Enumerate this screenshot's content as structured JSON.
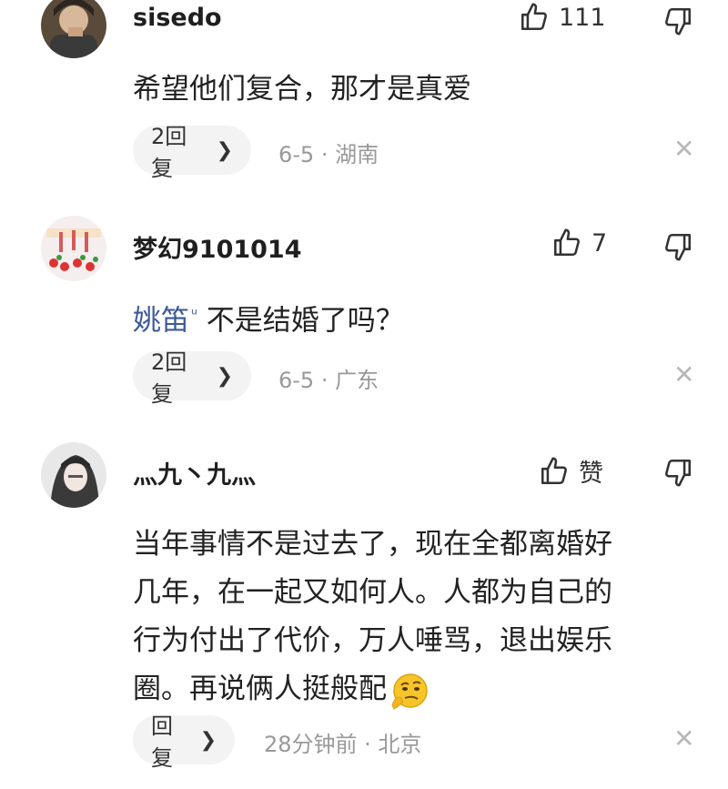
{
  "comments": [
    {
      "username": "sisedo",
      "likes": "111",
      "content": "希望他们复合，那才是真爱",
      "reply_label": "2回复",
      "meta": "6-5 · 湖南"
    },
    {
      "username": "梦幻9101014",
      "likes": "7",
      "mention": "姚笛",
      "content": "不是结婚了吗？",
      "reply_label": "2回复",
      "meta": "6-5 · 广东"
    },
    {
      "username": "灬九丶九灬",
      "likes": "赞",
      "content_lines": [
        "当年事情不是过去了，现在全都离婚好",
        "几年，在一起又如何人。人都为自己的",
        "行为付出了代价，万人唾骂，退出娱乐",
        "圈。再说俩人挺般配"
      ],
      "reply_label": "回复",
      "meta": "28分钟前 · 北京"
    }
  ],
  "icons": {
    "like": "thumbs-up-icon",
    "dislike": "thumbs-down-icon",
    "close": "close-icon",
    "chevron": "chevron-right-icon",
    "emoji": "thinking-emoji"
  },
  "colors": {
    "mention": "#3d5a99",
    "meta": "#999999",
    "pill_bg": "#f3f3f3"
  }
}
